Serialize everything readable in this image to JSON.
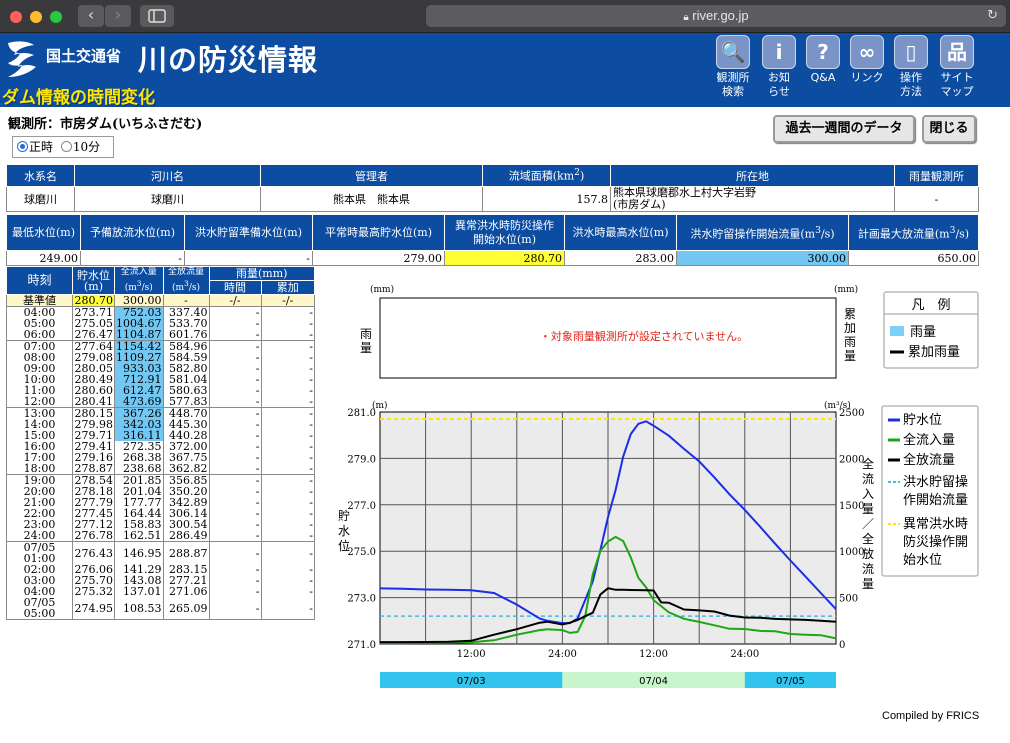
{
  "browser": {
    "url": "river.go.jp",
    "back": "‹",
    "forward": "›"
  },
  "header": {
    "org": "国土交通省",
    "site_title": "川の防災情報",
    "subtitle": "ダム情報の時間変化",
    "nav": [
      {
        "line1": "観測所",
        "line2": "検索",
        "icon": "search-icon",
        "glyph": "🔍"
      },
      {
        "line1": "お知",
        "line2": "らせ",
        "icon": "info-icon",
        "glyph": "i"
      },
      {
        "line1": "Q&A",
        "line2": "",
        "icon": "question-icon",
        "glyph": "?"
      },
      {
        "line1": "リンク",
        "line2": "",
        "icon": "link-icon",
        "glyph": "∞"
      },
      {
        "line1": "操作",
        "line2": "方法",
        "icon": "mouse-icon",
        "glyph": "▯"
      },
      {
        "line1": "サイト",
        "line2": "マップ",
        "icon": "sitemap-icon",
        "glyph": "品"
      }
    ]
  },
  "station_label": "観測所：市房ダム(いちふさだむ)",
  "buttons": {
    "week": "過去一週間のデータ",
    "close": "閉じる"
  },
  "radio": {
    "opt1": "正時",
    "opt2": "10分",
    "selected": "正時"
  },
  "info_table": {
    "headers": [
      "水系名",
      "河川名",
      "管理者",
      "流域面積(km²)",
      "所在地",
      "雨量観測所"
    ],
    "water_system": "球磨川",
    "river": "球磨川",
    "manager": "熊本県　熊本県",
    "area": "157.8",
    "location_1": "熊本県球磨郡水上村大字岩野",
    "location_2": "(市房ダム)",
    "rain_station": "-"
  },
  "level_table": {
    "headers": [
      "最低水位(m)",
      "予備放流水位(m)",
      "洪水貯留準備水位(m)",
      "平常時最高貯水位(m)",
      "異常洪水時防災操作開始水位(m)",
      "洪水時最高水位(m)",
      "洪水貯留操作開始流量(m³/s)",
      "計画最大放流量(m³/s)"
    ],
    "values": [
      "249.00",
      "-",
      "-",
      "279.00",
      "280.70",
      "283.00",
      "300.00",
      "650.00"
    ]
  },
  "obs_table": {
    "headers": {
      "time": "時刻",
      "level": "貯水位",
      "level_unit": "(m)",
      "inflow": "全流入量",
      "inflow_unit": "(m³/s)",
      "outflow": "全放流量",
      "outflow_unit": "(m³/s)",
      "rain": "雨量(mm)",
      "rain_time": "時間",
      "rain_cum": "累加"
    },
    "base": {
      "label": "基準値",
      "level": "280.70",
      "inflow": "300.00",
      "outflow": "-",
      "rain": "-/-",
      "cum": "-/-"
    },
    "rows": [
      {
        "t": "04:00",
        "l": "273.71",
        "i": "752.03",
        "o": "337.40",
        "hi": true,
        "grp": true
      },
      {
        "t": "05:00",
        "l": "275.05",
        "i": "1004.67",
        "o": "533.70",
        "hi": true
      },
      {
        "t": "06:00",
        "l": "276.47",
        "i": "1104.87",
        "o": "601.76",
        "hi": true
      },
      {
        "t": "07:00",
        "l": "277.64",
        "i": "1154.42",
        "o": "584.96",
        "hi": true,
        "grp": true
      },
      {
        "t": "08:00",
        "l": "279.08",
        "i": "1109.27",
        "o": "584.59",
        "hi": true
      },
      {
        "t": "09:00",
        "l": "280.05",
        "i": "933.03",
        "o": "582.80",
        "hi": true
      },
      {
        "t": "10:00",
        "l": "280.49",
        "i": "712.91",
        "o": "581.04",
        "hi": true
      },
      {
        "t": "11:00",
        "l": "280.60",
        "i": "612.47",
        "o": "580.63",
        "hi": true
      },
      {
        "t": "12:00",
        "l": "280.41",
        "i": "473.69",
        "o": "577.83",
        "hi": true
      },
      {
        "t": "13:00",
        "l": "280.15",
        "i": "367.26",
        "o": "448.70",
        "hi": true,
        "grp": true
      },
      {
        "t": "14:00",
        "l": "279.98",
        "i": "342.03",
        "o": "445.30",
        "hi": true
      },
      {
        "t": "15:00",
        "l": "279.71",
        "i": "316.11",
        "o": "440.28",
        "hi": true
      },
      {
        "t": "16:00",
        "l": "279.41",
        "i": "272.35",
        "o": "372.00"
      },
      {
        "t": "17:00",
        "l": "279.16",
        "i": "268.38",
        "o": "367.75"
      },
      {
        "t": "18:00",
        "l": "278.87",
        "i": "238.68",
        "o": "362.82"
      },
      {
        "t": "19:00",
        "l": "278.54",
        "i": "201.85",
        "o": "356.85",
        "grp": true
      },
      {
        "t": "20:00",
        "l": "278.18",
        "i": "201.04",
        "o": "350.20"
      },
      {
        "t": "21:00",
        "l": "277.79",
        "i": "177.77",
        "o": "342.89"
      },
      {
        "t": "22:00",
        "l": "277.45",
        "i": "164.44",
        "o": "306.14"
      },
      {
        "t": "23:00",
        "l": "277.12",
        "i": "158.83",
        "o": "300.54"
      },
      {
        "t": "24:00",
        "l": "276.78",
        "i": "162.51",
        "o": "286.49"
      },
      {
        "t": "07/05",
        "t2": "01:00",
        "l": "276.43",
        "i": "146.95",
        "o": "288.87",
        "grp": true
      },
      {
        "t": "02:00",
        "l": "276.06",
        "i": "141.29",
        "o": "283.15"
      },
      {
        "t": "03:00",
        "l": "275.70",
        "i": "143.08",
        "o": "277.21"
      },
      {
        "t": "04:00",
        "l": "275.32",
        "i": "137.01",
        "o": "271.06"
      },
      {
        "t": "07/05",
        "t2": "05:00",
        "l": "274.95",
        "i": "108.53",
        "o": "265.09",
        "last": true
      }
    ]
  },
  "rain_chart": {
    "unit_left": "(mm)",
    "unit_right": "(mm)",
    "ylabel_left": "雨量",
    "ylabel_right": "累加雨量",
    "message": "・対象雨量観測所が設定されていません。"
  },
  "rain_legend": {
    "title": "凡　例",
    "items": [
      "雨量",
      "累加雨量"
    ],
    "colors": [
      "#7ccff5",
      "#000000"
    ]
  },
  "chart_data": {
    "type": "line",
    "ylabel_left": "貯水位",
    "unit_left": "(m)",
    "ylabel_right": "全流入量／全放流量",
    "unit_right": "(m³/s)",
    "ylim_left": [
      271.0,
      281.0
    ],
    "ylim_right": [
      0,
      2500
    ],
    "yticks_left": [
      "281.0",
      "279.0",
      "277.0",
      "275.0",
      "273.0",
      "271.0"
    ],
    "yticks_right": [
      "2500",
      "2000",
      "1500",
      "1000",
      "500",
      "0"
    ],
    "xticks": [
      "12:00",
      "24:00",
      "12:00",
      "24:00"
    ],
    "x_hours": [
      0,
      3,
      6,
      9,
      12,
      15,
      18,
      21,
      24,
      27,
      30,
      33,
      36,
      39,
      42,
      45,
      48,
      51,
      54,
      57,
      60
    ],
    "date_bands": [
      {
        "label": "07/03",
        "start": 0,
        "end": 24,
        "color": "#33c4ee"
      },
      {
        "label": "07/04",
        "start": 24,
        "end": 48,
        "color": "#c8f5cc"
      },
      {
        "label": "07/05",
        "start": 48,
        "end": 60,
        "color": "#33c4ee"
      }
    ],
    "reference": {
      "level": 280.7,
      "flow": 300
    },
    "series": [
      {
        "name": "貯水位",
        "axis": "left",
        "color": "#1c2de8",
        "x": [
          0,
          3,
          6,
          9,
          12,
          15,
          18,
          21,
          22,
          24,
          25,
          26,
          28,
          29,
          30,
          31,
          32,
          33,
          34,
          35,
          36,
          38,
          40,
          42,
          44,
          46,
          48,
          50,
          52,
          54,
          56,
          58,
          60
        ],
        "values": [
          273.4,
          273.38,
          273.35,
          273.34,
          273.32,
          273.2,
          272.7,
          272.1,
          272.0,
          271.9,
          271.9,
          272.1,
          273.7,
          275.05,
          276.47,
          277.64,
          279.08,
          280.05,
          280.49,
          280.6,
          280.41,
          279.98,
          279.41,
          278.87,
          278.18,
          277.45,
          276.78,
          276.06,
          275.32,
          274.6,
          273.9,
          273.2,
          272.5
        ]
      },
      {
        "name": "全流入量",
        "axis": "right",
        "color": "#1fa614",
        "x": [
          0,
          3,
          6,
          9,
          12,
          15,
          18,
          21,
          22,
          24,
          25,
          26,
          27,
          28,
          29,
          30,
          31,
          32,
          33,
          34,
          35,
          36,
          38,
          40,
          42,
          44,
          46,
          48,
          50,
          52,
          54,
          56,
          58,
          60
        ],
        "values": [
          10,
          10,
          12,
          14,
          18,
          40,
          100,
          150,
          160,
          150,
          120,
          130,
          300,
          752,
          1004,
          1104,
          1154,
          1109,
          933,
          712,
          612,
          473,
          342,
          272,
          238,
          201,
          164,
          162,
          141,
          137,
          108,
          100,
          95,
          60
        ]
      },
      {
        "name": "全放流量",
        "axis": "right",
        "color": "#000000",
        "x": [
          0,
          3,
          6,
          9,
          12,
          15,
          18,
          21,
          22,
          24,
          25,
          26,
          27,
          28,
          29,
          30,
          31,
          32,
          33,
          34,
          35,
          36,
          37,
          38,
          40,
          42,
          44,
          46,
          48,
          50,
          52,
          54,
          56,
          58,
          60
        ],
        "values": [
          20,
          20,
          22,
          25,
          35,
          100,
          160,
          230,
          240,
          210,
          230,
          260,
          300,
          337,
          533,
          601,
          584,
          584,
          582,
          581,
          580,
          577,
          448,
          445,
          372,
          362,
          350,
          306,
          286,
          283,
          271,
          265,
          260,
          250,
          240
        ]
      }
    ]
  },
  "main_legend": {
    "items": [
      "貯水位",
      "全流入量",
      "全放流量",
      "洪水貯留操作開始流量",
      "異常洪水時防災操作開始水位"
    ],
    "colors": [
      "#1c2de8",
      "#1fa614",
      "#000000",
      "#45b8e8",
      "#ffe500"
    ]
  },
  "credit": "Compiled by FRICS"
}
